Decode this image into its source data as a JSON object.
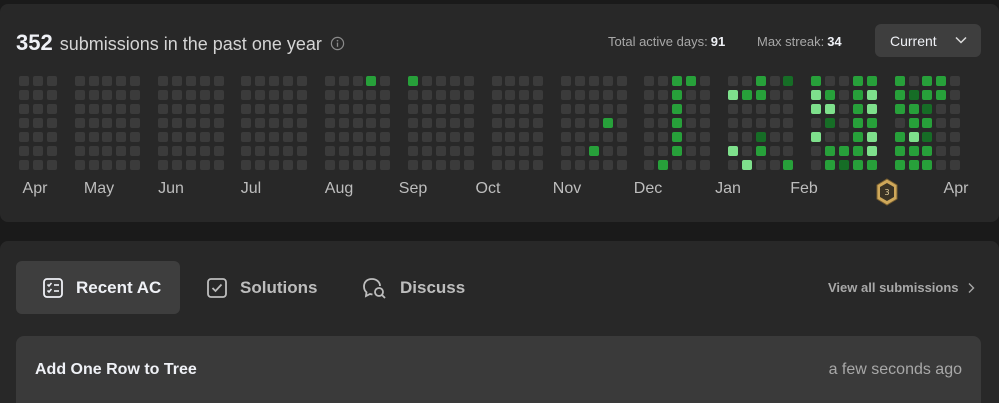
{
  "summary": {
    "count": "352",
    "count_label": "submissions in the past one year",
    "active_days_label": "Total active days:",
    "active_days_value": "91",
    "max_streak_label": "Max streak:",
    "max_streak_value": "34",
    "dropdown_value": "Current"
  },
  "months": [
    "Apr",
    "May",
    "Jun",
    "Jul",
    "Aug",
    "Sep",
    "Oct",
    "Nov",
    "Dec",
    "Jan",
    "Feb",
    "Apr"
  ],
  "badge_icon": "contest-badge-icon",
  "colors": {
    "empty": "#3b3b3b",
    "level1": "#166d26",
    "level2": "#27a03a",
    "level3": "#7ee08c",
    "card": "#282828"
  },
  "tabs": [
    {
      "label": "Recent AC",
      "icon": "checklist-icon",
      "active": true
    },
    {
      "label": "Solutions",
      "icon": "solution-icon",
      "active": false
    },
    {
      "label": "Discuss",
      "icon": "discuss-icon",
      "active": false
    }
  ],
  "view_all": "View all submissions",
  "recent": [
    {
      "title": "Add One Row to Tree",
      "time": "a few seconds ago"
    }
  ]
}
